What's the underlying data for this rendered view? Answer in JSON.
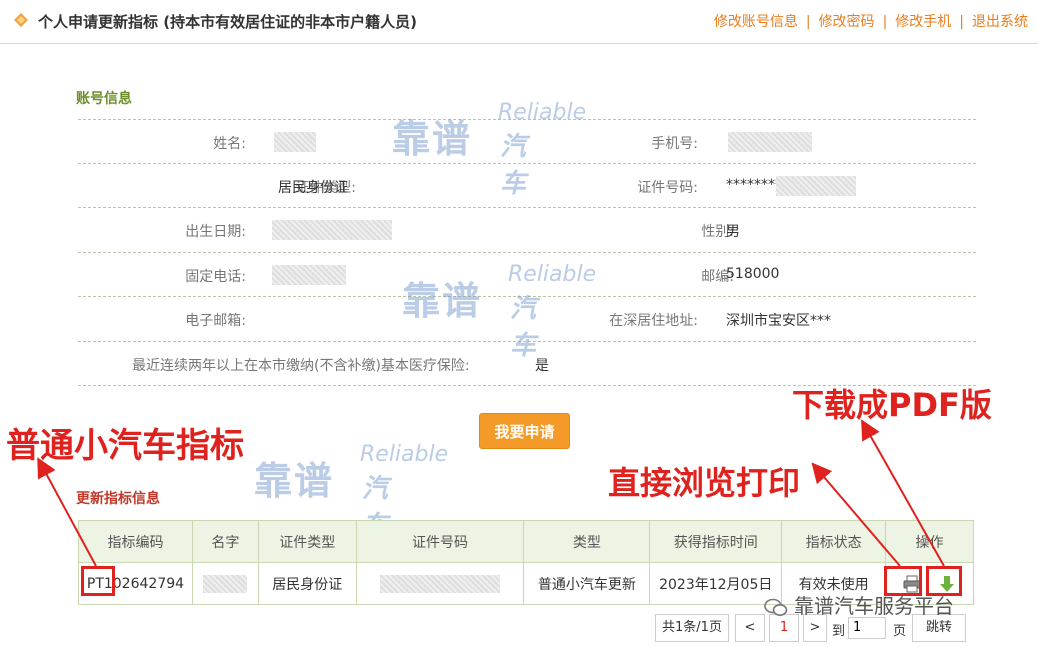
{
  "header": {
    "title": "个人申请更新指标 (持本市有效居住证的非本市户籍人员)",
    "links": [
      "修改账号信息",
      "修改密码",
      "修改手机",
      "退出系统"
    ],
    "separator": "|"
  },
  "account": {
    "section_title": "账号信息",
    "name_label": "姓名:",
    "phone_label": "手机号:",
    "id_type_label": "证件类型:",
    "id_type_value": "居民身份证",
    "id_no_label": "证件号码:",
    "id_no_value": "*********",
    "birth_label": "出生日期:",
    "gender_label": "性别:",
    "gender_value": "男",
    "tel_label": "固定电话:",
    "zip_label": "邮编:",
    "zip_value": "518000",
    "email_label": "电子邮箱:",
    "addr_label": "在深居住地址:",
    "addr_value": "深圳市宝安区***",
    "insurance_label": "最近连续两年以上在本市缴纳(不含补缴)基本医疗保险:",
    "insurance_value": "是"
  },
  "apply_button": "我要申请",
  "update": {
    "section_title": "更新指标信息",
    "columns": [
      "指标编码",
      "名字",
      "证件类型",
      "证件号码",
      "类型",
      "获得指标时间",
      "指标状态",
      "操作"
    ],
    "row": {
      "code": "PT102642794",
      "id_type": "居民身份证",
      "type": "普通小汽车更新",
      "time": "2023年12月05日",
      "status": "有效未使用"
    },
    "icons": [
      "printer-icon",
      "download-icon"
    ]
  },
  "pager": {
    "summary": "共1条/1页",
    "prev": "<",
    "current": "1",
    "next": ">",
    "goto_label": "到",
    "goto_value": "1",
    "page_unit": "页",
    "jump": "跳转"
  },
  "annotations": {
    "pdf": "下载成PDF版",
    "print": "直接浏览打印",
    "quota": "普通小汽车指标"
  },
  "watermark": {
    "cn": "靠谱",
    "en": "Reliable",
    "cn2": "汽车"
  },
  "wechat_brand": "靠谱汽车服务平台",
  "colors": {
    "accent_orange": "#f39a28",
    "link_orange": "#e87d1e",
    "section_green": "#6d8f2a",
    "annotation_red": "#e0221f"
  }
}
